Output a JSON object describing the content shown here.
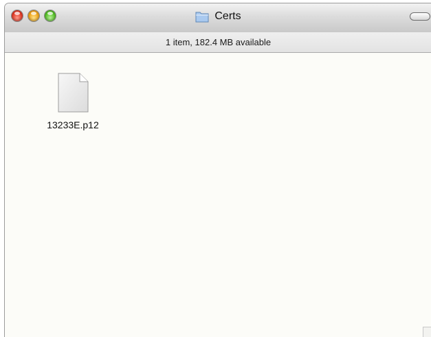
{
  "window": {
    "title": "Certs",
    "title_icon": "folder-icon"
  },
  "statusbar": {
    "text": "1 item, 182.4 MB available"
  },
  "files": [
    {
      "name": "13233E.p12",
      "icon": "document-icon"
    }
  ],
  "colors": {
    "close": "#e23b28",
    "minimize": "#f0a51a",
    "zoom": "#56c128",
    "content_background": "#fcfcf8"
  }
}
